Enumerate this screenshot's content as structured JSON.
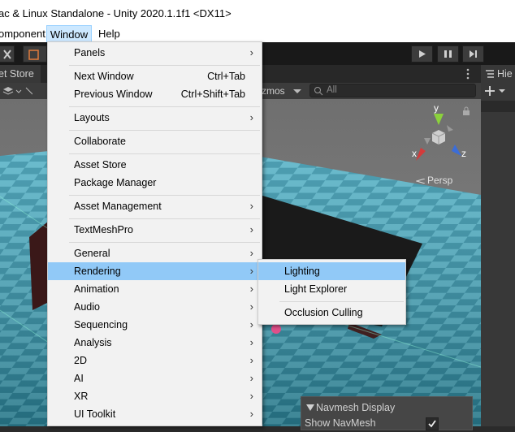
{
  "window": {
    "title": "ac & Linux Standalone - Unity 2020.1.1f1 <DX11>"
  },
  "menubar": {
    "items": [
      "omponent",
      "Window",
      "Help"
    ]
  },
  "scene": {
    "tab_label": "et Store",
    "gizmos_label": "zmos",
    "search_placeholder": "All",
    "persp_label": "Persp",
    "axis": {
      "x": "x",
      "y": "y",
      "z": "z"
    }
  },
  "navmesh": {
    "title": "Navmesh Display",
    "show_label": "Show NavMesh"
  },
  "window_menu": {
    "items": [
      {
        "label": "Panels",
        "submenu": true
      },
      {
        "label": "Next Window",
        "shortcut": "Ctrl+Tab"
      },
      {
        "label": "Previous Window",
        "shortcut": "Ctrl+Shift+Tab"
      },
      {
        "label": "Layouts",
        "submenu": true
      },
      {
        "label": "Collaborate"
      },
      {
        "label": "Asset Store"
      },
      {
        "label": "Package Manager"
      },
      {
        "label": "Asset Management",
        "submenu": true
      },
      {
        "label": "TextMeshPro",
        "submenu": true
      },
      {
        "label": "General",
        "submenu": true
      },
      {
        "label": "Rendering",
        "submenu": true,
        "highlighted": true
      },
      {
        "label": "Animation",
        "submenu": true
      },
      {
        "label": "Audio",
        "submenu": true
      },
      {
        "label": "Sequencing",
        "submenu": true
      },
      {
        "label": "Analysis",
        "submenu": true
      },
      {
        "label": "2D",
        "submenu": true
      },
      {
        "label": "AI",
        "submenu": true
      },
      {
        "label": "XR",
        "submenu": true
      },
      {
        "label": "UI Toolkit",
        "submenu": true
      }
    ]
  },
  "rendering_menu": {
    "items": [
      {
        "label": "Lighting",
        "highlighted": true
      },
      {
        "label": "Light Explorer"
      },
      {
        "label": "Occlusion Culling"
      }
    ]
  },
  "hierarchy": {
    "tab_label": "Hie"
  },
  "colors": {
    "menu_highlight": "#91c9f7",
    "menubar_active": "#cce8ff"
  }
}
